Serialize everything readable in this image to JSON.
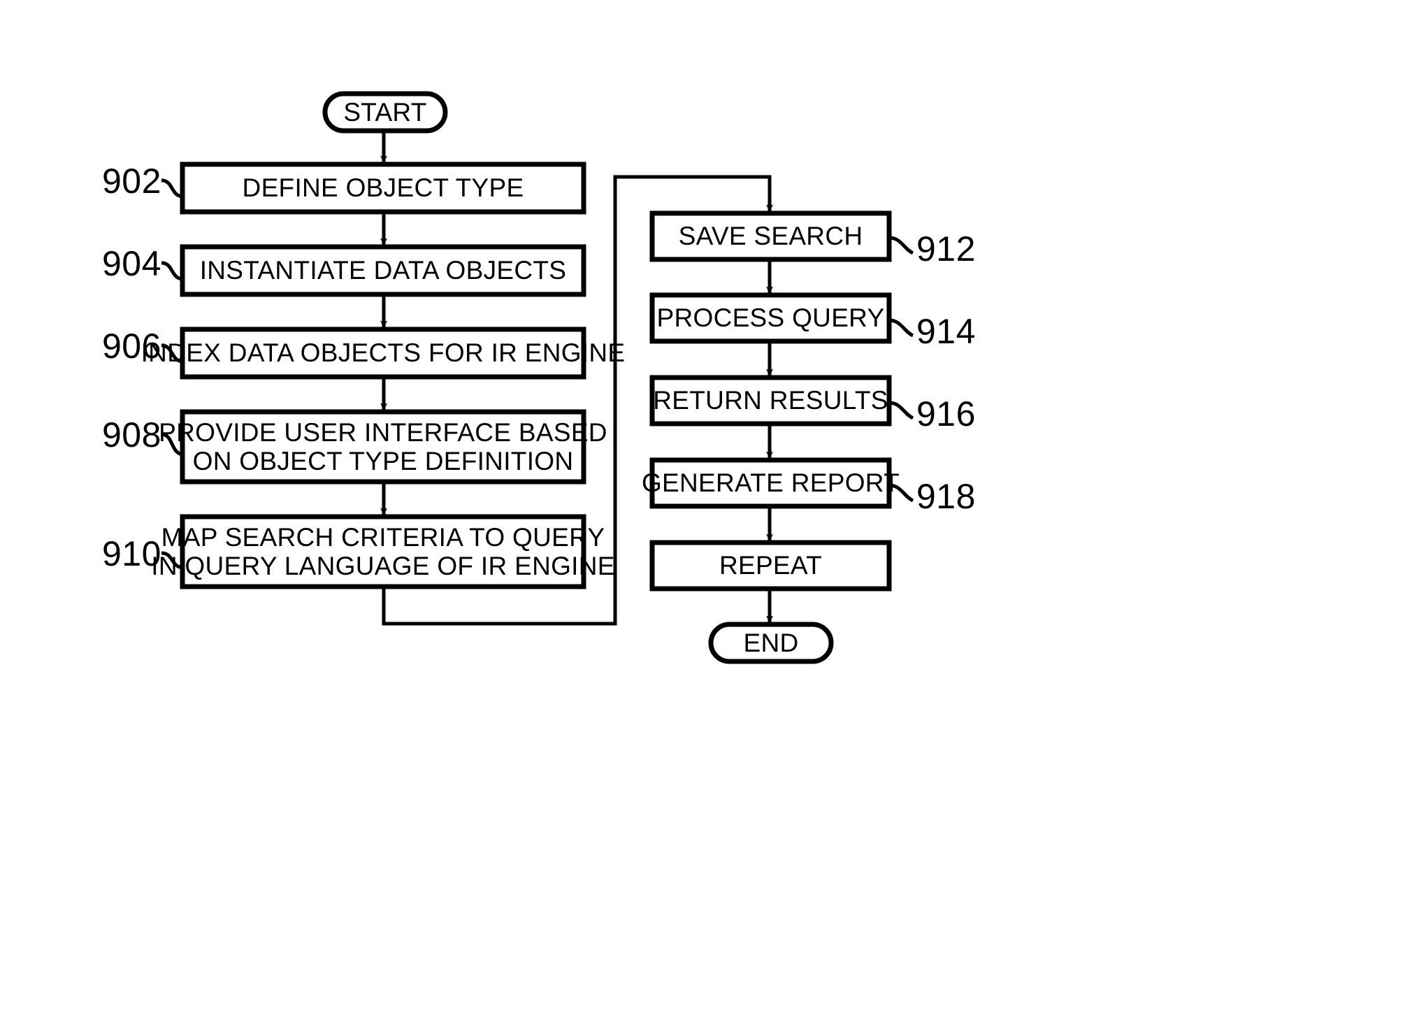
{
  "figure": {
    "type": "flowchart",
    "orientation": "two-column",
    "terminators": {
      "start": "START",
      "end": "END"
    },
    "left_column": [
      {
        "ref": "902",
        "label": "DEFINE OBJECT TYPE",
        "lines": [
          "DEFINE OBJECT TYPE"
        ]
      },
      {
        "ref": "904",
        "label": "INSTANTIATE DATA OBJECTS",
        "lines": [
          "INSTANTIATE DATA OBJECTS"
        ]
      },
      {
        "ref": "906",
        "label": "INDEX DATA OBJECTS FOR IR ENGINE",
        "lines": [
          "INDEX DATA OBJECTS FOR IR ENGINE"
        ]
      },
      {
        "ref": "908",
        "label": "PROVIDE USER INTERFACE BASED ON OBJECT TYPE DEFINITION",
        "lines": [
          "PROVIDE USER INTERFACE BASED",
          "ON OBJECT TYPE DEFINITION"
        ]
      },
      {
        "ref": "910",
        "label": "MAP SEARCH CRITERIA TO QUERY IN QUERY LANGUAGE OF IR ENGINE",
        "lines": [
          "MAP SEARCH CRITERIA TO QUERY",
          "IN QUERY LANGUAGE OF IR ENGINE"
        ]
      }
    ],
    "right_column": [
      {
        "ref": "912",
        "label": "SAVE SEARCH",
        "lines": [
          "SAVE SEARCH"
        ]
      },
      {
        "ref": "914",
        "label": "PROCESS QUERY",
        "lines": [
          "PROCESS QUERY"
        ]
      },
      {
        "ref": "916",
        "label": "RETURN RESULTS",
        "lines": [
          "RETURN RESULTS"
        ]
      },
      {
        "ref": "918",
        "label": "GENERATE REPORT",
        "lines": [
          "GENERATE REPORT"
        ]
      },
      {
        "ref": "",
        "label": "REPEAT",
        "lines": [
          "REPEAT"
        ]
      }
    ],
    "colors": {
      "stroke": "#000000",
      "fill": "#ffffff",
      "text": "#000000"
    }
  }
}
